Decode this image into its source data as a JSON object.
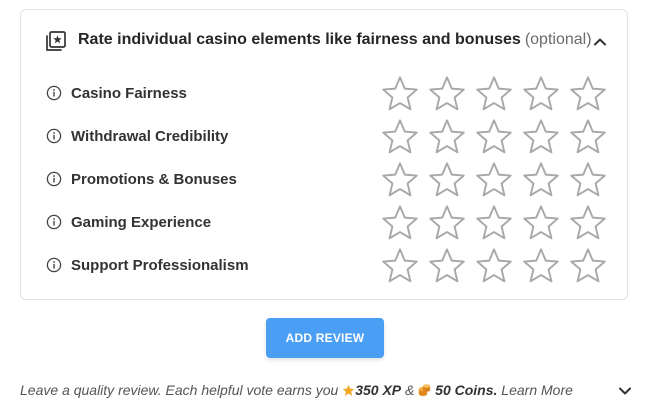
{
  "rating_section": {
    "title": "Rate individual casino elements like fairness and bonuses",
    "optional_label": "(optional)",
    "header_icon": "star-card-icon",
    "collapse_icon": "chevron-up-icon",
    "max_stars": 5,
    "rows": [
      {
        "label": "Casino Fairness",
        "rating": 0
      },
      {
        "label": "Withdrawal Credibility",
        "rating": 0
      },
      {
        "label": "Promotions & Bonuses",
        "rating": 0
      },
      {
        "label": "Gaming Experience",
        "rating": 0
      },
      {
        "label": "Support Professionalism",
        "rating": 0
      }
    ]
  },
  "add_review_button": {
    "label": "ADD REVIEW",
    "color": "#4a9ff5"
  },
  "footer": {
    "text_prefix": "Leave a quality review. Each helpful vote earns you ",
    "xp_amount": "350 XP",
    "separator": " & ",
    "coins_amount": "50 Coins.",
    "learn_more": "Learn More",
    "xp_icon": "star-icon",
    "coins_icon": "coins-icon",
    "expand_icon": "chevron-down-icon"
  },
  "colors": {
    "star_outline": "#a8a8a8",
    "xp_star": "#f5a623",
    "coin": "#f0a030"
  }
}
